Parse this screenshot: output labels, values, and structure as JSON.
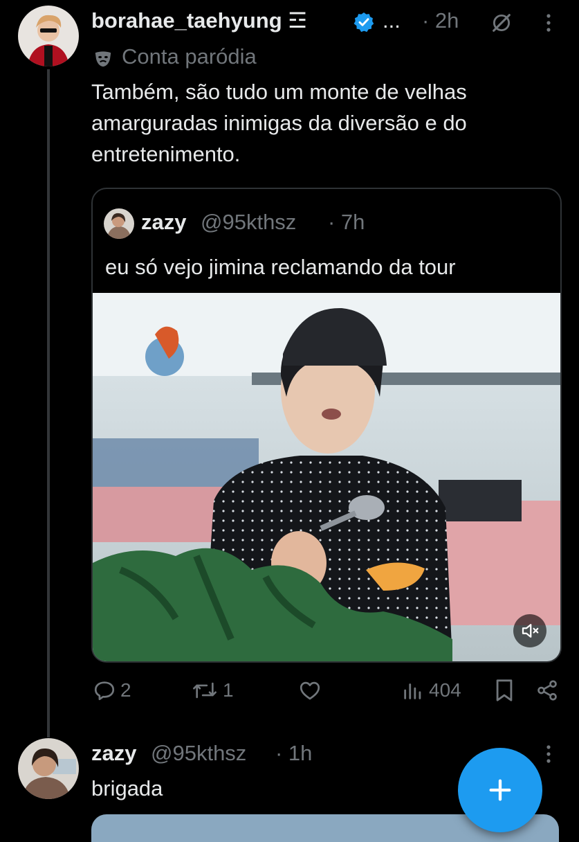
{
  "main_tweet": {
    "display_name": "borahae_taehyung",
    "name_emoji": "☲",
    "verified": true,
    "ellipsis": "...",
    "time": "· 2h",
    "parody_label": "Conta paródia",
    "text": "Também, são tudo um monte de velhas amarguradas inimigas da diversão e do entretenimento."
  },
  "quoted_tweet": {
    "display_name": "zazy",
    "handle": "@95kthsz",
    "time": "· 7h",
    "text": "eu só vejo jimina reclamando da tour"
  },
  "actions": {
    "replies": "2",
    "retweets": "1",
    "views": "404"
  },
  "reply_tweet": {
    "display_name": "zazy",
    "handle": "@95kthsz",
    "time": "· 1h",
    "text": "brigada"
  },
  "icons": {
    "verified": "verified-badge-icon",
    "parody": "parody-mask-icon",
    "grok": "grok-icon",
    "more": "more-vertical-icon",
    "reply": "reply-icon",
    "retweet": "retweet-icon",
    "like": "heart-icon",
    "views": "views-bar-icon",
    "bookmark": "bookmark-icon",
    "share": "share-icon",
    "mute": "mute-icon",
    "compose": "plus-icon"
  },
  "colors": {
    "background": "#000000",
    "text_primary": "#e7e9ea",
    "text_secondary": "#71767b",
    "accent": "#1d9bf0",
    "border": "#2f3336"
  }
}
